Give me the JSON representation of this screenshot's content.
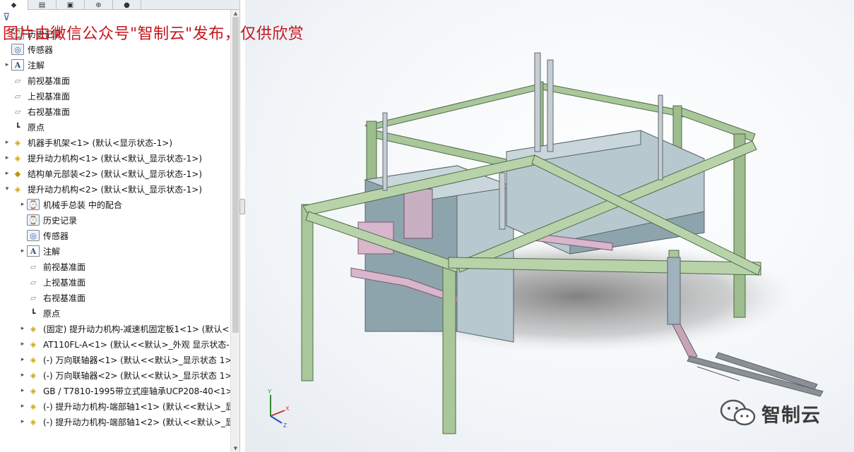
{
  "watermark": "图片由微信公众号\"智制云\"发布，仅供欣赏",
  "logo_text": "智制云",
  "panel": {
    "tabs": [
      "feature-manager-icon",
      "property-manager-icon",
      "configuration-manager-icon",
      "dimxpert-icon",
      "display-manager-icon"
    ],
    "filter_icon": "filter-icon"
  },
  "tree": [
    {
      "level": 0,
      "expand": "",
      "icon": "history",
      "label": "历史记录"
    },
    {
      "level": 0,
      "expand": "",
      "icon": "sensor",
      "label": "传感器"
    },
    {
      "level": 0,
      "expand": "▸",
      "icon": "note",
      "label": "注解"
    },
    {
      "level": 0,
      "expand": "",
      "icon": "plane",
      "label": "前视基准面"
    },
    {
      "level": 0,
      "expand": "",
      "icon": "plane",
      "label": "上视基准面"
    },
    {
      "level": 0,
      "expand": "",
      "icon": "plane",
      "label": "右视基准面"
    },
    {
      "level": 0,
      "expand": "",
      "icon": "origin",
      "label": "原点"
    },
    {
      "level": 0,
      "expand": "▸",
      "icon": "part",
      "label": "机器手机架<1> (默认<显示状态-1>)"
    },
    {
      "level": 0,
      "expand": "▸",
      "icon": "part",
      "label": "提升动力机构<1> (默认<默认_显示状态-1>)"
    },
    {
      "level": 0,
      "expand": "▸",
      "icon": "asm",
      "label": "结构单元部装<2> (默认<默认_显示状态-1>)"
    },
    {
      "level": 0,
      "expand": "▾",
      "icon": "part",
      "label": "提升动力机构<2> (默认<默认_显示状态-1>)"
    },
    {
      "level": 1,
      "expand": "▸",
      "icon": "history",
      "label": "机械手总装 中的配合"
    },
    {
      "level": 1,
      "expand": "",
      "icon": "history",
      "label": "历史记录"
    },
    {
      "level": 1,
      "expand": "",
      "icon": "sensor",
      "label": "传感器"
    },
    {
      "level": 1,
      "expand": "▸",
      "icon": "note",
      "label": "注解"
    },
    {
      "level": 1,
      "expand": "",
      "icon": "plane",
      "label": "前视基准面"
    },
    {
      "level": 1,
      "expand": "",
      "icon": "plane",
      "label": "上视基准面"
    },
    {
      "level": 1,
      "expand": "",
      "icon": "plane",
      "label": "右视基准面"
    },
    {
      "level": 1,
      "expand": "",
      "icon": "origin",
      "label": "原点"
    },
    {
      "level": 1,
      "expand": "▸",
      "icon": "part",
      "label": "(固定) 提升动力机构-减速机固定板1<1> (默认<"
    },
    {
      "level": 1,
      "expand": "▸",
      "icon": "part",
      "label": "AT110FL-A<1> (默认<<默认>_外观 显示状态-"
    },
    {
      "level": 1,
      "expand": "▸",
      "icon": "part",
      "label": "(-) 万向联轴器<1> (默认<<默认>_显示状态 1>"
    },
    {
      "level": 1,
      "expand": "▸",
      "icon": "part",
      "label": "(-) 万向联轴器<2> (默认<<默认>_显示状态 1>"
    },
    {
      "level": 1,
      "expand": "▸",
      "icon": "part",
      "label": "GB / T7810-1995带立式座轴承UCP208-40<1>"
    },
    {
      "level": 1,
      "expand": "▸",
      "icon": "part",
      "label": "(-) 提升动力机构-端部轴1<1> (默认<<默认>_显"
    },
    {
      "level": 1,
      "expand": "▸",
      "icon": "part",
      "label": "(-) 提升动力机构-端部轴1<2> (默认<<默认>_显"
    }
  ],
  "colors": {
    "frame": "#a9c79a",
    "frame_dark": "#6f8f62",
    "box": "#b7c8cf",
    "box_dark": "#8ea4ad",
    "pink": "#d8b6cc",
    "watermark": "#c8141c"
  },
  "triad_labels": {
    "x": "X",
    "y": "Y",
    "z": "Z"
  }
}
